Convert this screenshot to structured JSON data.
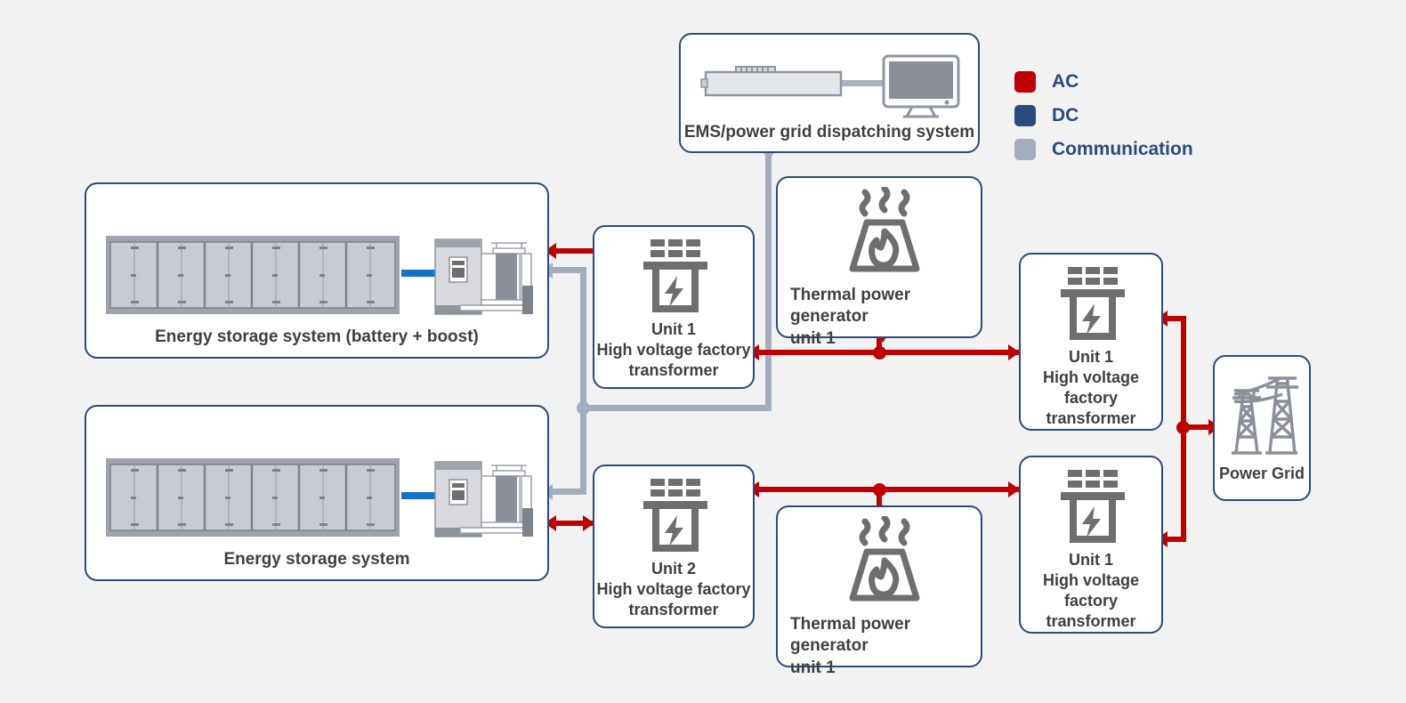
{
  "legend": {
    "items": [
      {
        "label": "AC",
        "color": "#c00000",
        "icon": "ac-swatch"
      },
      {
        "label": "DC",
        "color": "#2b4a7e",
        "icon": "dc-swatch"
      },
      {
        "label": "Communication",
        "color": "#a3adbe",
        "icon": "communication-swatch"
      }
    ]
  },
  "nodes": {
    "ems": {
      "label": "EMS/power grid dispatching system",
      "icons": [
        "server-icon",
        "monitor-icon"
      ]
    },
    "ess_top": {
      "label": "Energy storage system (battery + boost)",
      "icons": [
        "battery-container-icon",
        "pcs-cabinet-icon",
        "boost-transformer-icon"
      ]
    },
    "ess_bottom": {
      "label": "Energy storage system",
      "icons": [
        "battery-container-icon",
        "pcs-cabinet-icon",
        "boost-transformer-icon"
      ]
    },
    "xfmr_mid_top": {
      "label": "Unit 1\nHigh voltage factory\ntransformer",
      "icon": "transformer-icon"
    },
    "xfmr_mid_bottom": {
      "label": "Unit 2\nHigh voltage factory\ntransformer",
      "icon": "transformer-icon"
    },
    "thermal_top": {
      "label": "Thermal power generator\nunit 1",
      "icon": "thermal-plant-icon"
    },
    "thermal_bottom": {
      "label": "Thermal power generator\nunit 1",
      "icon": "thermal-plant-icon"
    },
    "xfmr_right_top": {
      "label": "Unit 1\nHigh voltage\nfactory\ntransformer",
      "icon": "transformer-icon"
    },
    "xfmr_right_bottom": {
      "label": "Unit 1\nHigh voltage\nfactory\ntransformer",
      "icon": "transformer-icon"
    },
    "power_grid": {
      "label": "Power Grid",
      "icon": "transmission-tower-icon"
    }
  },
  "colors": {
    "ac": "#c00000",
    "dc": "#2b4a7e",
    "dc_line": "#1572c8",
    "communication": "#a3adbe",
    "card_border": "#2b4a7e",
    "background": "#f2f2f2",
    "icon_gray": "#6e6e6e",
    "text": "#404040"
  }
}
